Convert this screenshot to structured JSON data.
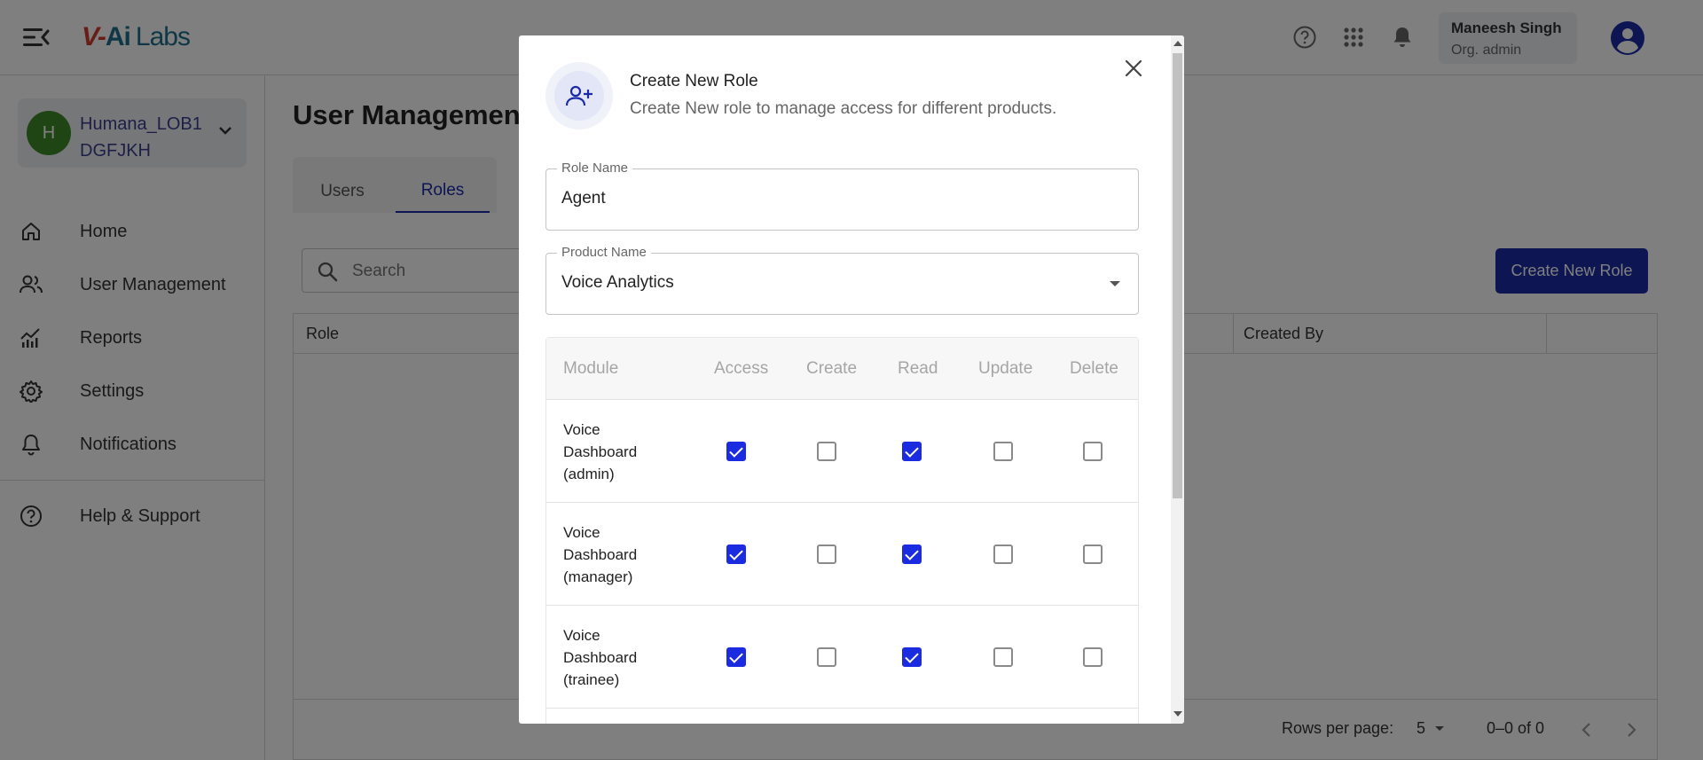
{
  "topbar": {
    "logo_part1": "V-",
    "logo_part2": "Ai",
    "logo_part3": "Labs",
    "user_name": "Maneesh Singh",
    "user_role": "Org. admin"
  },
  "sidebar": {
    "org_initial": "H",
    "org_name_line1": "Humana_LOB1",
    "org_name_line2": "DGFJKH",
    "items": [
      {
        "label": "Home",
        "icon": "home-icon"
      },
      {
        "label": "User Management",
        "icon": "users-icon"
      },
      {
        "label": "Reports",
        "icon": "chart-icon"
      },
      {
        "label": "Settings",
        "icon": "gear-icon"
      },
      {
        "label": "Notifications",
        "icon": "bell-icon"
      },
      {
        "label": "Help & Support",
        "icon": "help-icon"
      }
    ]
  },
  "main": {
    "title": "User Management",
    "tabs": [
      {
        "label": "Users"
      },
      {
        "label": "Roles"
      }
    ],
    "active_tab": "Roles",
    "search_placeholder": "Search",
    "create_button": "Create New Role",
    "table_headers": {
      "role": "Role",
      "created_by": "Created By"
    },
    "pagination": {
      "rows_per_page_label": "Rows per page:",
      "rows_per_page": "5",
      "range": "0–0 of 0"
    }
  },
  "dialog": {
    "title": "Create New Role",
    "subtitle": "Create New role to manage access for different products.",
    "role_name_label": "Role Name",
    "role_name_value": "Agent",
    "product_label": "Product Name",
    "product_value": "Voice Analytics",
    "permission_headers": [
      "Module",
      "Access",
      "Create",
      "Read",
      "Update",
      "Delete"
    ],
    "permissions": [
      {
        "module": "Voice Dashboard (admin)",
        "access": true,
        "create": false,
        "read": true,
        "update": false,
        "delete": false
      },
      {
        "module": "Voice Dashboard (manager)",
        "access": true,
        "create": false,
        "read": true,
        "update": false,
        "delete": false
      },
      {
        "module": "Voice Dashboard (trainee)",
        "access": true,
        "create": false,
        "read": true,
        "update": false,
        "delete": false
      }
    ]
  },
  "colors": {
    "accent": "#1b2ba6",
    "checkbox_checked": "#1b2be0",
    "org_avatar": "#3f8a2a",
    "logo_red": "#d13b2f",
    "logo_teal": "#1f6e8c"
  }
}
